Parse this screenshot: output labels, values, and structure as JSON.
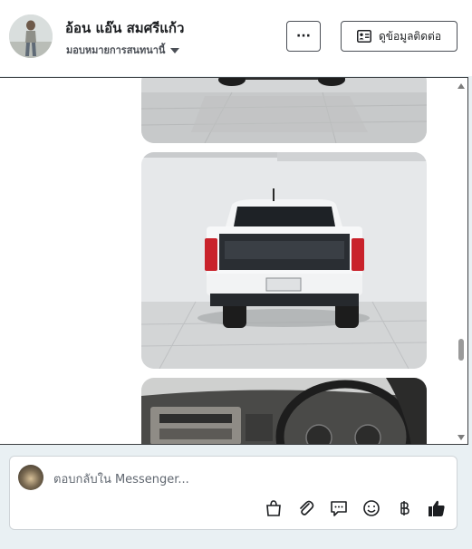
{
  "header": {
    "contact_name": "อ้อน แอ๊น สมศรีแก้ว",
    "assign_label": "มอบหมายการสนทนานี้",
    "more_label": "···",
    "contact_info_label": "ดูข้อมูลติดต่อ"
  },
  "thread": {
    "photos": [
      {
        "description": "car-photo-partial-top"
      },
      {
        "description": "white-pickup-truck-rear-view"
      },
      {
        "description": "car-interior-dashboard"
      }
    ]
  },
  "reply": {
    "placeholder": "ตอบกลับใน Messenger...",
    "tools": [
      "shopping-bag-icon",
      "paperclip-icon",
      "chat-bubble-icon",
      "emoji-icon",
      "baht-icon",
      "thumbs-up-icon"
    ]
  },
  "colors": {
    "page_background": "#e9f0f3",
    "thumbs_up": "#1c1e21"
  }
}
